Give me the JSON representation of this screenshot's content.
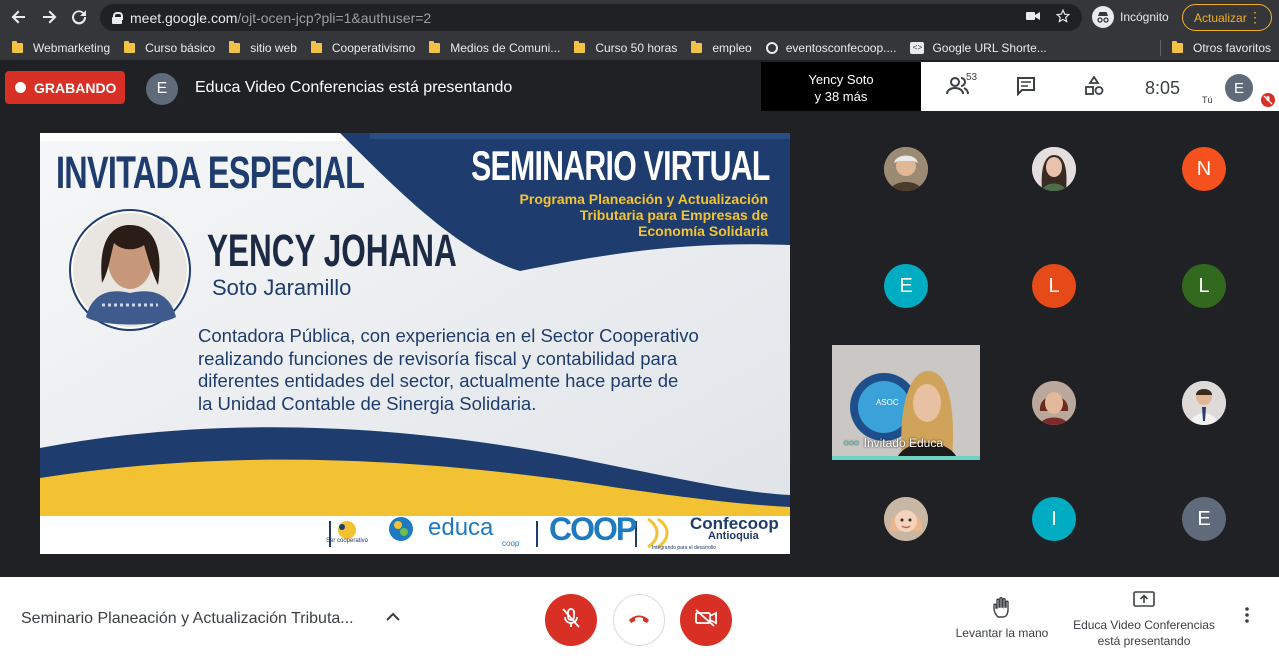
{
  "browser": {
    "url_host": "meet.google.com",
    "url_path": "/ojt-ocen-jcp?pli=1&authuser=2",
    "incognito_label": "Incógnito",
    "update_label": "Actualizar"
  },
  "bookmarks": {
    "items": [
      {
        "label": "Webmarketing",
        "icon": "folder-icon"
      },
      {
        "label": "Curso básico",
        "icon": "folder-icon"
      },
      {
        "label": "sitio web",
        "icon": "folder-icon"
      },
      {
        "label": "Cooperativismo",
        "icon": "folder-icon"
      },
      {
        "label": "Medios de Comuni...",
        "icon": "folder-icon"
      },
      {
        "label": "Curso 50 horas",
        "icon": "folder-icon"
      },
      {
        "label": "empleo",
        "icon": "folder-icon"
      },
      {
        "label": "eventosconfecoop....",
        "icon": "globe-icon"
      },
      {
        "label": "Google URL Shorte...",
        "icon": "link-icon"
      }
    ],
    "other_label": "Otros favoritos"
  },
  "meet_header": {
    "recording_label": "GRABANDO",
    "presenter_initial": "E",
    "presenting_text": "Educa Video Conferencias está presentando",
    "participants_line1": "Yency Soto",
    "participants_line2": "y 38 más",
    "people_count": "53",
    "time": "8:05",
    "self_initial": "E",
    "self_label": "Tú"
  },
  "slide": {
    "header_left": "INVITADA ESPECIAL",
    "header_right": "SEMINARIO VIRTUAL",
    "program_line1": "Programa Planeación y Actualización",
    "program_line2": "Tributaria para Empresas de",
    "program_line3": "Economía Solidaria",
    "guest_name": "YENCY JOHANA",
    "guest_surname": "Soto Jaramillo",
    "bio_line1": "Contadora Pública, con experiencia en el Sector Cooperativo",
    "bio_line2": "realizando funciones de revisoría fiscal y contabilidad para",
    "bio_line3": "diferentes entidades del sector, actualmente hace parte de",
    "bio_line4": "la Unidad Contable de Sinergia Solidaria.",
    "logo1": "Ser cooperativo",
    "logo2": "educa",
    "logo2_sub": "coop",
    "logo3": "COOP",
    "logo4": "Confecoop",
    "logo4_sub": "Antioquia",
    "logo4_tag": "Integrando para el desarrollo"
  },
  "participants": [
    {
      "type": "photo",
      "icon": "avatar-photo-1"
    },
    {
      "type": "photo",
      "icon": "avatar-photo-2"
    },
    {
      "type": "initial",
      "initial": "N",
      "color": "#f4511e"
    },
    {
      "type": "initial",
      "initial": "E",
      "color": "#00acc1"
    },
    {
      "type": "initial",
      "initial": "L",
      "color": "#e64a19"
    },
    {
      "type": "initial",
      "initial": "L",
      "color": "#33691e"
    },
    {
      "type": "video",
      "label": "Invitado Educa"
    },
    {
      "type": "photo",
      "icon": "avatar-photo-3"
    },
    {
      "type": "photo",
      "icon": "avatar-photo-4"
    },
    {
      "type": "photo",
      "icon": "avatar-photo-5"
    },
    {
      "type": "initial",
      "initial": "I",
      "color": "#00acc1"
    },
    {
      "type": "initial",
      "initial": "E",
      "color": "#5f6b7a"
    }
  ],
  "bottom_bar": {
    "meeting_title": "Seminario Planeación y Actualización Tributa...",
    "raise_hand_label": "Levantar la mano",
    "presenting_line1": "Educa Video Conferencias",
    "presenting_line2": "está presentando"
  },
  "colors": {
    "record_red": "#d93025",
    "slide_navy": "#1f3c6e",
    "slide_yellow": "#f2c232",
    "program_gold": "#f4c430"
  }
}
